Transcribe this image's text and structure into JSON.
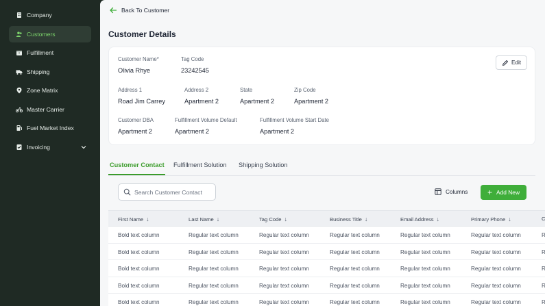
{
  "sidebar": {
    "items": [
      {
        "label": "Company",
        "icon": "building-icon",
        "active": false
      },
      {
        "label": "Customers",
        "icon": "users-icon",
        "active": true
      },
      {
        "label": "Fulfillment",
        "icon": "box-icon",
        "active": false
      },
      {
        "label": "Shipping",
        "icon": "truck-icon",
        "active": false
      },
      {
        "label": "Zone Matrix",
        "icon": "location-pin-icon",
        "active": false
      },
      {
        "label": "Master Carrier",
        "icon": "motorcycle-icon",
        "active": false
      },
      {
        "label": "Fuel Market Index",
        "icon": "fuel-icon",
        "active": false
      },
      {
        "label": "Invoicing",
        "icon": "invoice-icon",
        "active": false,
        "expandable": true
      }
    ]
  },
  "header": {
    "back_label": "Back To Customer",
    "title": "Customer Details"
  },
  "details": {
    "edit_label": "Edit",
    "fields": [
      {
        "label": "Customer Name*",
        "value": "Olivia Rhye"
      },
      {
        "label": "Tag Code",
        "value": "23242545"
      },
      {
        "label": "Address 1",
        "value": "Road Jim Carrey"
      },
      {
        "label": "Address 2",
        "value": "Apartment 2"
      },
      {
        "label": "State",
        "value": "Apartment 2"
      },
      {
        "label": "Zip Code",
        "value": "Apartment 2"
      },
      {
        "label": "Customer DBA",
        "value": "Apartment 2"
      },
      {
        "label": "Fulfillment Volume Default",
        "value": "Apartment 2"
      },
      {
        "label": "Fulfillment Volume Start Date",
        "value": "Apartment 2"
      }
    ]
  },
  "tabs": [
    {
      "label": "Customer Contact",
      "active": true
    },
    {
      "label": "Fulfillment Solution",
      "active": false
    },
    {
      "label": "Shipping Solution",
      "active": false
    }
  ],
  "toolbar": {
    "search_placeholder": "Search Customer Contact",
    "columns_label": "Columns",
    "add_label": "Add New"
  },
  "table": {
    "columns": [
      "First Name",
      "Last Name",
      "Tag Code",
      "Business Title",
      "Email Address",
      "Primary Phone",
      "C"
    ],
    "rows": [
      [
        "Bold text column",
        "Regular text column",
        "Regular text column",
        "Regular text column",
        "Regular text column",
        "Regular text column",
        "R"
      ],
      [
        "Bold text column",
        "Regular text column",
        "Regular text column",
        "Regular text column",
        "Regular text column",
        "Regular text column",
        "R"
      ],
      [
        "Bold text column",
        "Regular text column",
        "Regular text column",
        "Regular text column",
        "Regular text column",
        "Regular text column",
        "R"
      ],
      [
        "Bold text column",
        "Regular text column",
        "Regular text column",
        "Regular text column",
        "Regular text column",
        "Regular text column",
        "R"
      ],
      [
        "Bold text column",
        "Regular text column",
        "Regular text column",
        "Regular text column",
        "Regular text column",
        "Regular text column",
        "R"
      ]
    ]
  },
  "colors": {
    "sidebar_bg": "#1f2a24",
    "accent": "#3fae3a",
    "active_text": "#7cd36b"
  }
}
